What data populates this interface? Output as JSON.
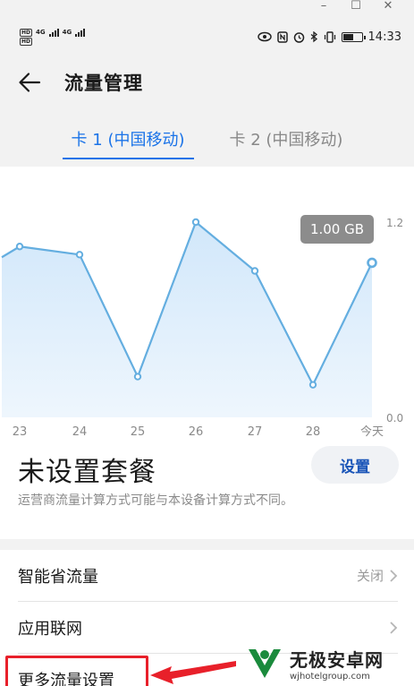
{
  "status_bar": {
    "sim1_network": "4G",
    "sim2_network": "4G",
    "hd_label": "HD",
    "time": "14:33",
    "battery_level": 0.6
  },
  "header": {
    "title": "流量管理"
  },
  "sim_tabs": [
    {
      "label": "卡 1 (中国移动)",
      "active": true
    },
    {
      "label": "卡 2 (中国移动)",
      "active": false
    }
  ],
  "chart_data": {
    "type": "area",
    "categories": [
      "23",
      "24",
      "25",
      "26",
      "27",
      "28",
      "今天"
    ],
    "values": [
      1.05,
      1.0,
      0.25,
      1.2,
      0.9,
      0.2,
      0.95
    ],
    "ylim": [
      0,
      1.2
    ],
    "y_tick_labels": [
      "1.2",
      "0.0"
    ],
    "highlight_label": "1.00 GB",
    "line_color": "#64aee0",
    "fill_color": "#cfe6fa",
    "grid": false
  },
  "plan": {
    "title": "未设置套餐",
    "setup_button": "设置",
    "note": "运营商流量计算方式可能与本设备计算方式不同。"
  },
  "settings": [
    {
      "label": "智能省流量",
      "value": "关闭"
    },
    {
      "label": "应用联网",
      "value": ""
    },
    {
      "label": "更多流量设置",
      "value": ""
    }
  ],
  "annotation": {
    "box_color": "#e8202a"
  },
  "watermark": {
    "text": "无极安卓网",
    "url": "wjhotelgroup.com"
  }
}
